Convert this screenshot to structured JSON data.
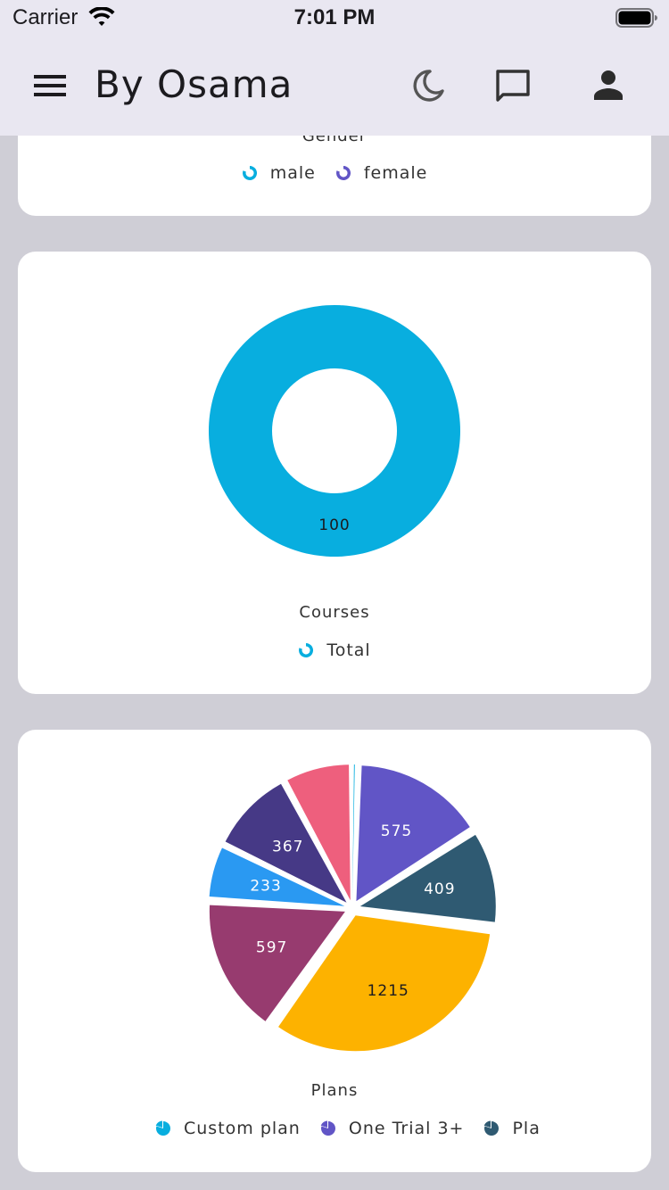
{
  "status_bar": {
    "carrier": "Carrier",
    "time": "7:01 PM"
  },
  "app_bar": {
    "title": "By Osama",
    "menu_icon": "menu-icon",
    "actions": [
      "moon-icon",
      "chat-icon",
      "person-icon"
    ]
  },
  "gender_card": {
    "title": "Gender",
    "legend": [
      {
        "label": "male",
        "color": "#08aedf"
      },
      {
        "label": "female",
        "color": "#6155c6"
      }
    ]
  },
  "courses_card": {
    "title": "Courses",
    "legend": [
      {
        "label": "Total",
        "color": "#08aedf"
      }
    ]
  },
  "plans_card": {
    "title": "Plans",
    "legend": [
      {
        "label": "Custom plan",
        "color": "#08aedf"
      },
      {
        "label": "One Trial 3+",
        "color": "#6155c6"
      },
      {
        "label": "Pla",
        "color": "#2f5a72"
      }
    ]
  },
  "chart_data": [
    {
      "type": "pie",
      "title": "Courses",
      "variant": "doughnut",
      "categories": [
        "Total"
      ],
      "values": [
        100
      ],
      "colors": [
        "#08aedf"
      ]
    },
    {
      "type": "pie",
      "title": "Plans",
      "variant": "exploded",
      "values": [
        17,
        575,
        409,
        1215,
        597,
        233,
        367,
        291
      ],
      "colors": [
        "#08aedf",
        "#6155c6",
        "#2f5a72",
        "#fdb200",
        "#973b6f",
        "#2a99f2",
        "#463986",
        "#ee5f7d"
      ],
      "labels": [
        "",
        "575",
        "409",
        "1215",
        "597",
        "233",
        "367",
        ""
      ],
      "legend_visible": [
        "Custom plan",
        "One Trial 3+",
        "Pla"
      ]
    }
  ]
}
